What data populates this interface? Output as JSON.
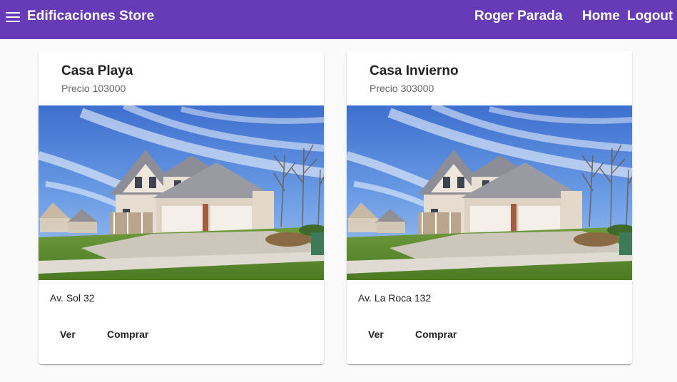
{
  "header": {
    "brand": "Edificaciones Store",
    "user_name": "Roger Parada",
    "nav_home": "Home",
    "nav_logout": "Logout"
  },
  "colors": {
    "toolbar": "#673ab7",
    "background": "#fafafa",
    "card": "#ffffff"
  },
  "icons": {
    "menu": "menu-icon"
  },
  "cards": [
    {
      "title": "Casa Playa",
      "subtitle": "Precio 103000",
      "address": "Av. Sol 32",
      "view_label": "Ver",
      "buy_label": "Comprar"
    },
    {
      "title": "Casa Invierno",
      "subtitle": "Precio 303000",
      "address": "Av. La Roca 132",
      "view_label": "Ver",
      "buy_label": "Comprar"
    }
  ]
}
